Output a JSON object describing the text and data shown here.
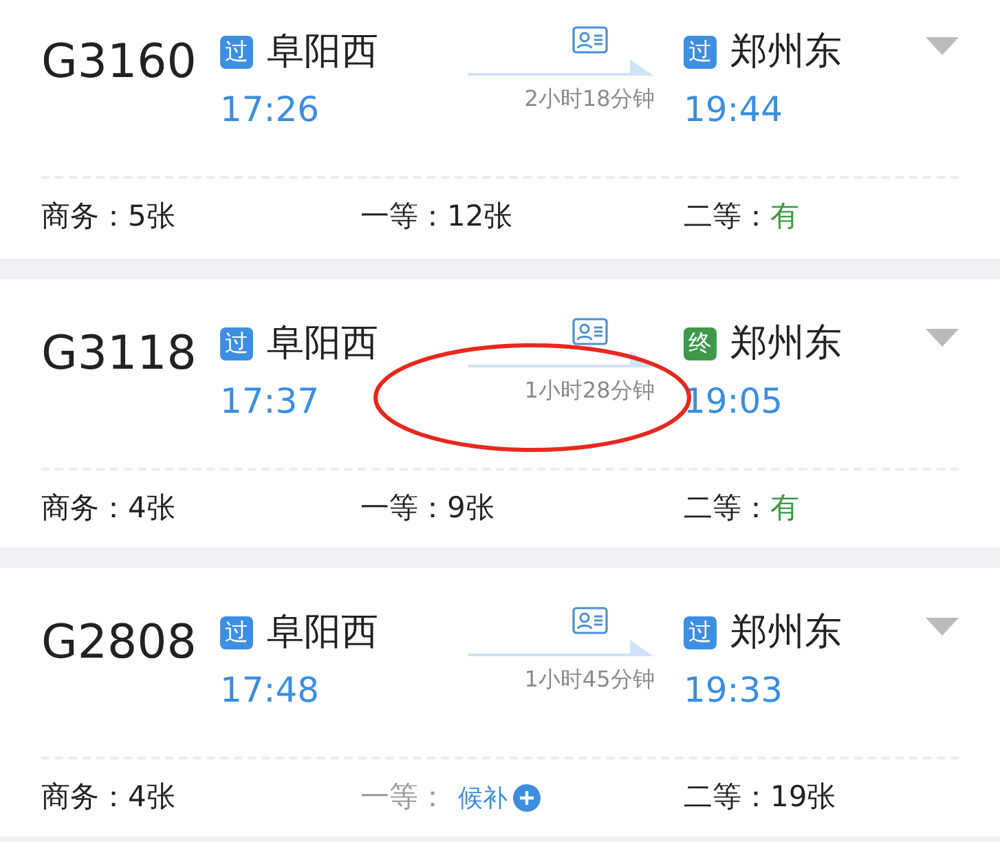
{
  "trains": [
    {
      "number": "G3160",
      "from": {
        "badge": "过",
        "color": "#3d8fe4",
        "station": "阜阳西",
        "time": "17:26"
      },
      "duration": "2小时18分钟",
      "to": {
        "badge": "过",
        "color": "#3d8fe4",
        "station": "郑州东",
        "time": "19:44"
      },
      "circled": false,
      "seats": [
        {
          "label": "商务：",
          "value": "5张",
          "kind": "count"
        },
        {
          "label": "一等：",
          "value": "12张",
          "kind": "count"
        },
        {
          "label": "二等：",
          "value": "有",
          "kind": "available"
        }
      ]
    },
    {
      "number": "G3118",
      "from": {
        "badge": "过",
        "color": "#3d8fe4",
        "station": "阜阳西",
        "time": "17:37"
      },
      "duration": "1小时28分钟",
      "to": {
        "badge": "终",
        "color": "#3c9a4a",
        "station": "郑州东",
        "time": "19:05"
      },
      "circled": true,
      "seats": [
        {
          "label": "商务：",
          "value": "4张",
          "kind": "count"
        },
        {
          "label": "一等：",
          "value": "9张",
          "kind": "count"
        },
        {
          "label": "二等：",
          "value": "有",
          "kind": "available"
        }
      ]
    },
    {
      "number": "G2808",
      "from": {
        "badge": "过",
        "color": "#3d8fe4",
        "station": "阜阳西",
        "time": "17:48"
      },
      "duration": "1小时45分钟",
      "to": {
        "badge": "过",
        "color": "#3d8fe4",
        "station": "郑州东",
        "time": "19:33"
      },
      "circled": false,
      "seats": [
        {
          "label": "商务：",
          "value": "4张",
          "kind": "count"
        },
        {
          "label": "一等：",
          "value": "候补",
          "kind": "waitlist"
        },
        {
          "label": "二等：",
          "value": "19张",
          "kind": "count"
        }
      ]
    }
  ]
}
